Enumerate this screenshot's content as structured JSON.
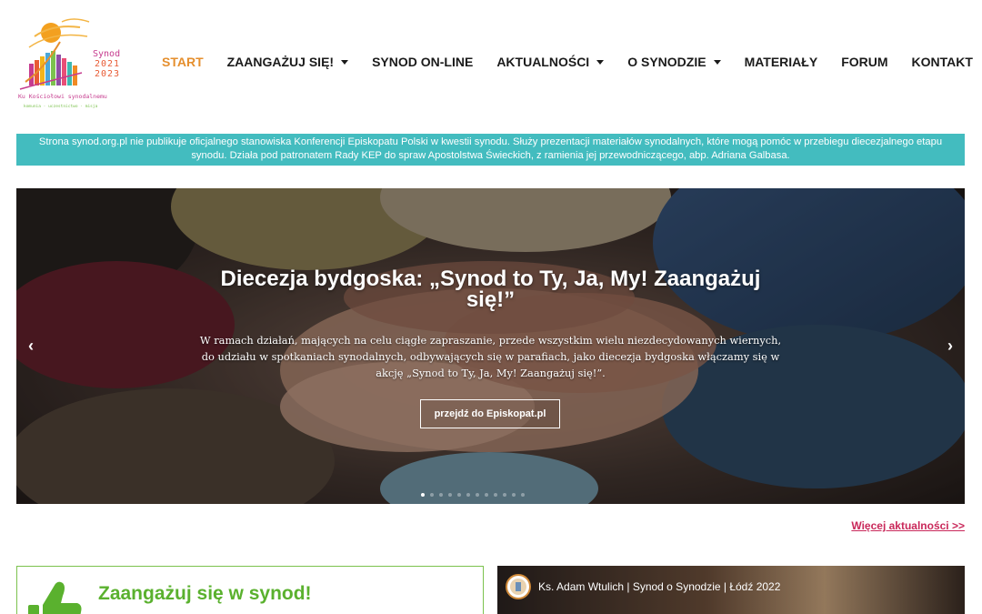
{
  "logo": {
    "word": "Synod",
    "year_start": "2021",
    "year_end": "2023",
    "tagline": "Ku Kościołowi synodalnemu",
    "subtitle": "komunia · uczestnictwo · misja"
  },
  "nav": {
    "items": [
      {
        "label": "START",
        "active": true,
        "dropdown": false
      },
      {
        "label": "ZAANGAŻUJ SIĘ!",
        "active": false,
        "dropdown": true
      },
      {
        "label": "SYNOD ON-LINE",
        "active": false,
        "dropdown": false
      },
      {
        "label": "AKTUALNOŚCI",
        "active": false,
        "dropdown": true
      },
      {
        "label": "O SYNODZIE",
        "active": false,
        "dropdown": true
      },
      {
        "label": "MATERIAŁY",
        "active": false,
        "dropdown": false
      },
      {
        "label": "FORUM",
        "active": false,
        "dropdown": false
      },
      {
        "label": "KONTAKT",
        "active": false,
        "dropdown": false
      }
    ]
  },
  "notice": {
    "text": "Strona synod.org.pl nie publikuje oficjalnego stanowiska Konferencji Episkopatu Polski w kwestii synodu.  Służy prezentacji materiałów synodalnych, które mogą pomóc w przebiegu diecezjalnego etapu synodu. Działa pod patronatem Rady KEP do spraw Apostolstwa Świeckich, z ramienia jej przewodniczącego, abp. Adriana Galbasa."
  },
  "hero": {
    "title": "Diecezja bydgoska: „Synod to Ty, Ja, My! Zaangażuj się!”",
    "description": "W ramach działań, mających na celu ciągłe zapraszanie, przede wszystkim wielu niezdecydowanych wiernych, do udziału w spotkaniach synodalnych, odbywających się w parafiach, jako diecezja bydgoska włączamy się w akcję „Synod to Ty, Ja, My! Zaangażuj się!”.",
    "button_label": "przejdź do Episkopat.pl",
    "prev_arrow": "‹",
    "next_arrow": "›",
    "slide_count": 12,
    "active_slide": 0
  },
  "more_news": {
    "label": "Więcej aktualności >>"
  },
  "engage_card": {
    "title": "Zaangażuj się w synod!"
  },
  "video": {
    "title": "Ks. Adam Wtulich | Synod o Synodzie | Łódź 2022"
  },
  "colors": {
    "accent_orange": "#e58f2e",
    "notice_teal": "#43bcbf",
    "link_pink": "#c9285a",
    "green": "#5ab12e"
  }
}
